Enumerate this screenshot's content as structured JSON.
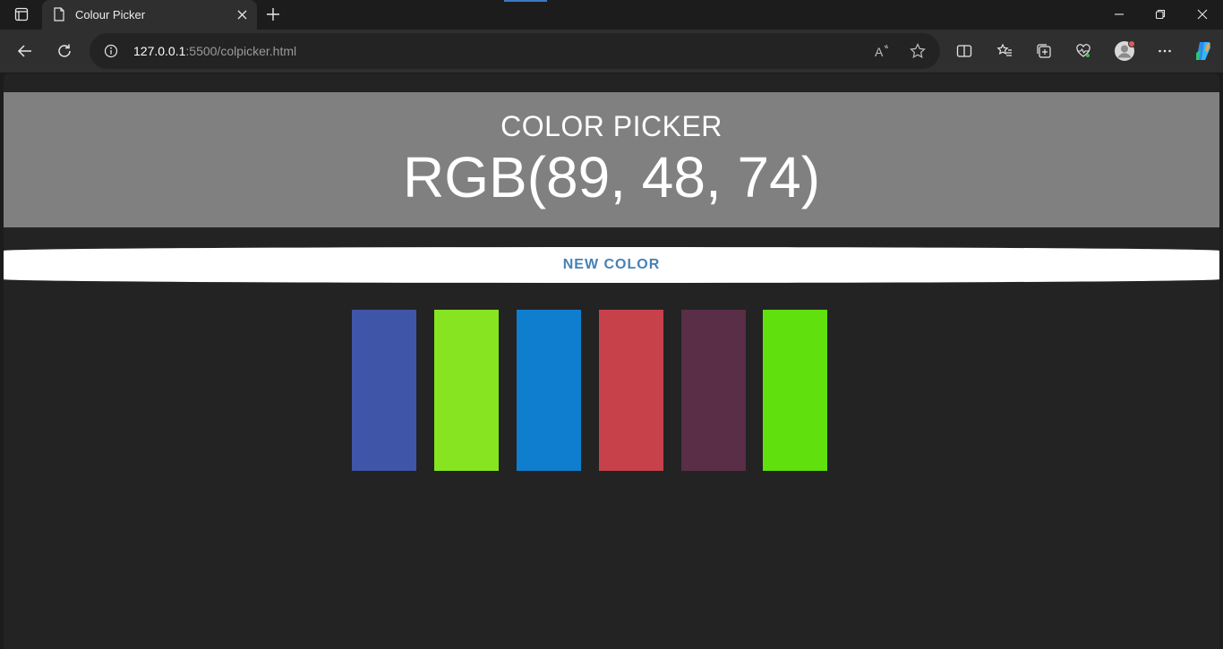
{
  "browser": {
    "tab": {
      "title": "Colour Picker"
    },
    "address": {
      "host": "127.0.0.1",
      "rest": ":5500/colpicker.html"
    }
  },
  "page": {
    "title": "COLOR PICKER",
    "rgb_display": "RGB(89, 48, 74)",
    "header_color": "#808080",
    "new_color_button": "NEW COLOR",
    "swatches": [
      {
        "color": "#3f55a8"
      },
      {
        "color": "#87e421"
      },
      {
        "color": "#0f7ecf"
      },
      {
        "color": "#c7414b"
      },
      {
        "color": "#592e46"
      },
      {
        "color": "#60e00c"
      }
    ]
  }
}
